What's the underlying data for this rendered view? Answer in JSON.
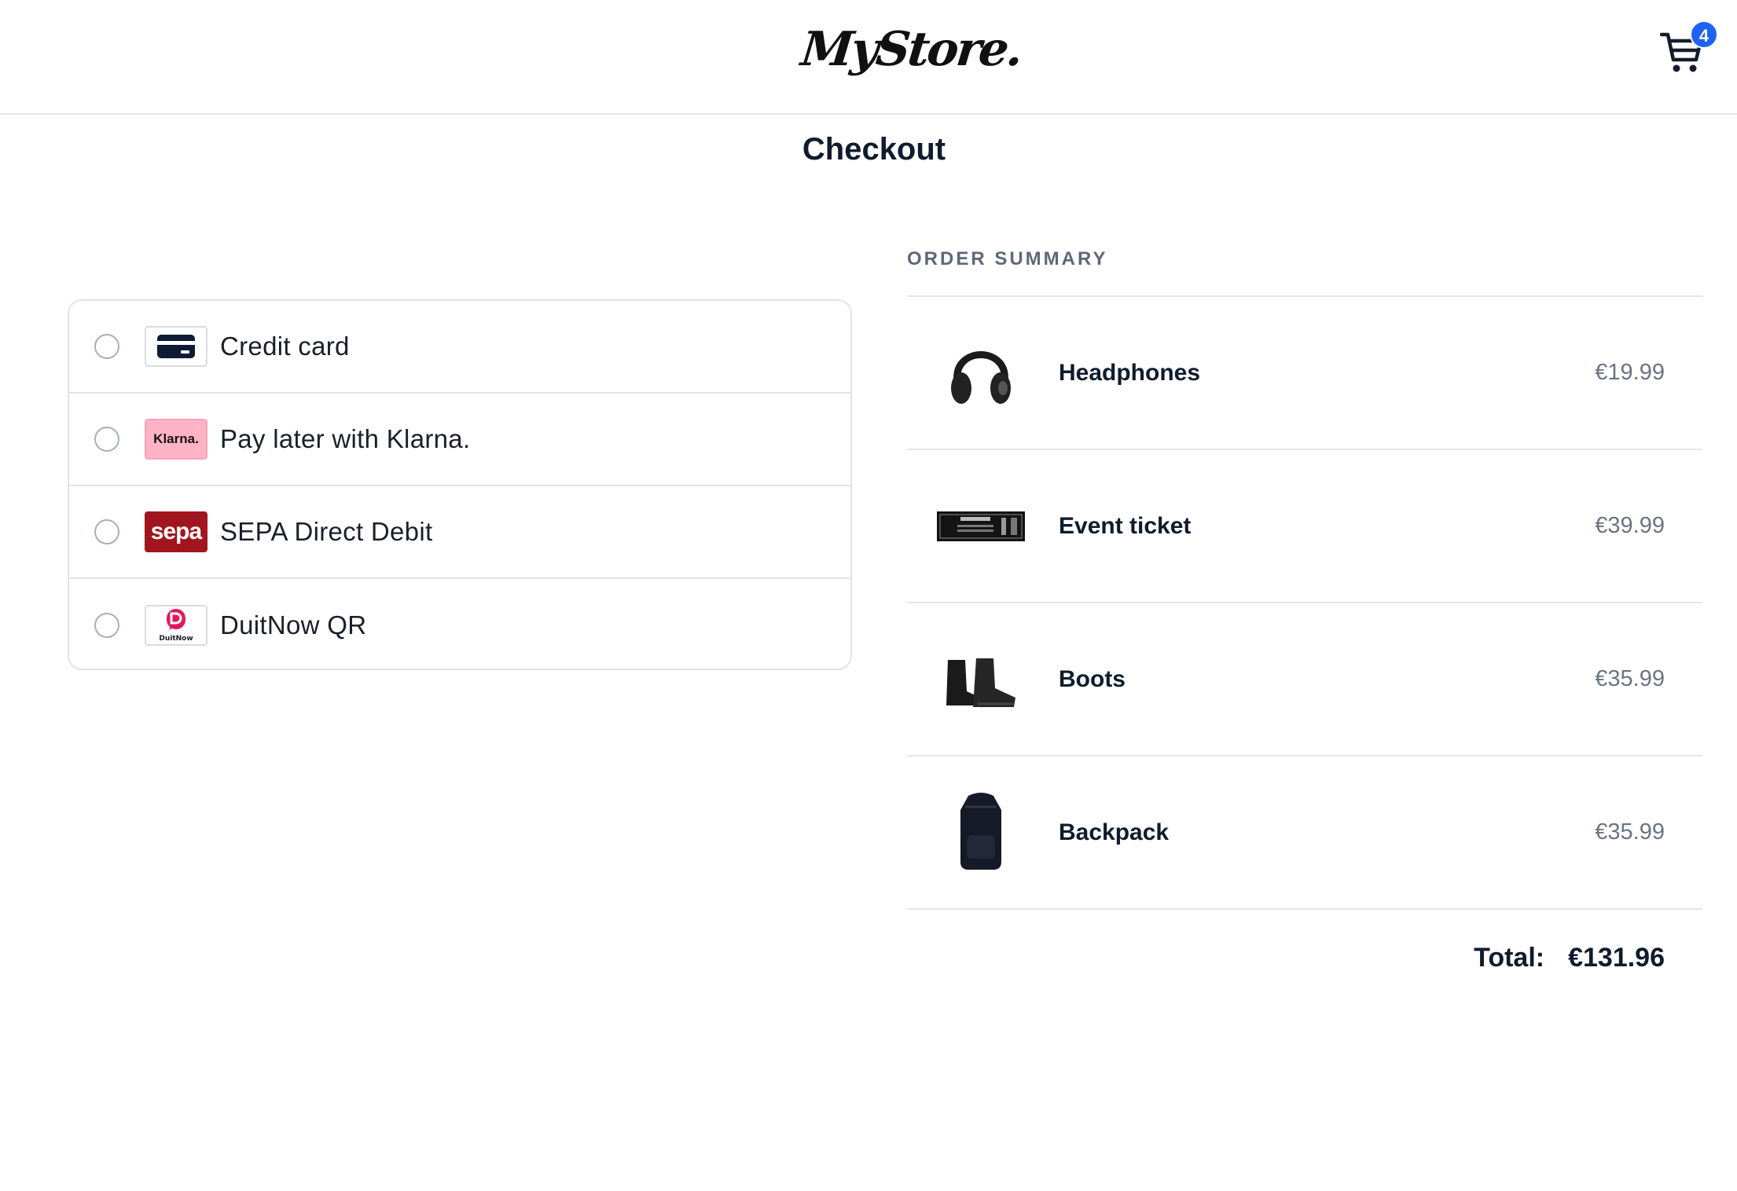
{
  "header": {
    "logo_text": "MyStore.",
    "cart_count": "4"
  },
  "page": {
    "title": "Checkout"
  },
  "payment_methods": [
    {
      "label": "Credit card",
      "icon": "credit-card-icon"
    },
    {
      "label": "Pay later with Klarna.",
      "icon": "klarna-logo",
      "logo_text": "Klarna."
    },
    {
      "label": "SEPA Direct Debit",
      "icon": "sepa-logo",
      "logo_text": "sepa"
    },
    {
      "label": "DuitNow QR",
      "icon": "duitnow-logo",
      "logo_text": "DuitNow"
    }
  ],
  "summary": {
    "title": "ORDER SUMMARY",
    "items": [
      {
        "name": "Headphones",
        "price": "€19.99",
        "icon": "headphones-image"
      },
      {
        "name": "Event ticket",
        "price": "€39.99",
        "icon": "ticket-image"
      },
      {
        "name": "Boots",
        "price": "€35.99",
        "icon": "boots-image"
      },
      {
        "name": "Backpack",
        "price": "€35.99",
        "icon": "backpack-image"
      }
    ],
    "total_label": "Total:",
    "total_value": "€131.96"
  },
  "colors": {
    "accent": "#1f62f2",
    "sepa": "#a1151f",
    "klarna": "#ffb3c7",
    "duitnow": "#e4175a"
  }
}
